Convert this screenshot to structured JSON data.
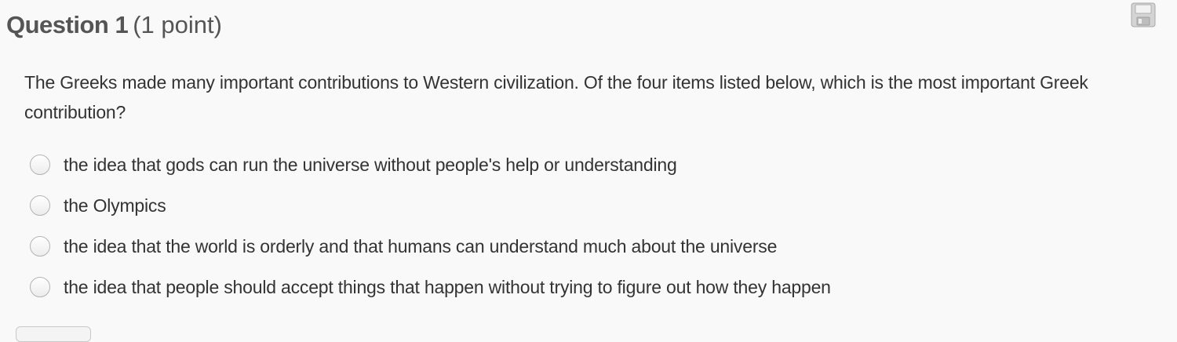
{
  "question": {
    "label": "Question 1",
    "points": "(1 point)",
    "prompt": "The Greeks made many important contributions to Western civilization. Of the four items listed below, which is the most important Greek contribution?",
    "options": [
      {
        "label": "the idea that gods can run the universe without people's help or understanding"
      },
      {
        "label": "the Olympics"
      },
      {
        "label": "the idea that the world is orderly and that humans can understand much about the universe"
      },
      {
        "label": "the idea that people should accept things that happen without trying to figure out how they happen"
      }
    ]
  },
  "icons": {
    "save": "floppy-disk-icon"
  },
  "colors": {
    "background": "#f9f9f9",
    "title": "#555555",
    "text": "#333333",
    "radio_border": "#b3b3b3"
  }
}
